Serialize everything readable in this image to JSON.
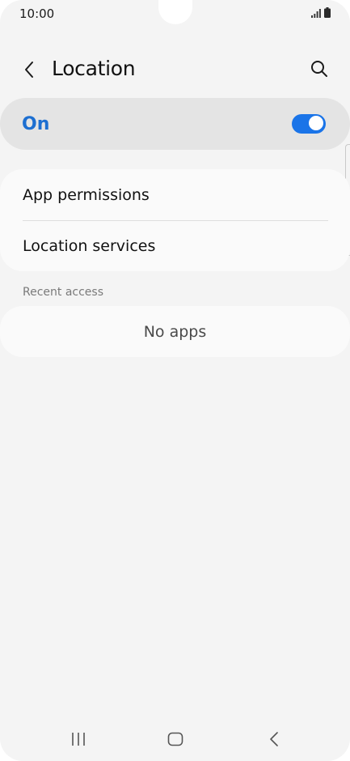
{
  "status_bar": {
    "time": "10:00",
    "icons": [
      "signal-icon",
      "battery-icon"
    ]
  },
  "header": {
    "title": "Location",
    "back_icon": "chevron-left-icon",
    "search_icon": "search-icon"
  },
  "master_toggle": {
    "label": "On",
    "checked": true,
    "accent": "#1a74e8",
    "label_color": "#1d6fd1"
  },
  "menu": {
    "items": [
      {
        "label": "App permissions"
      },
      {
        "label": "Location services"
      }
    ]
  },
  "recent_access": {
    "section_label": "Recent access",
    "empty_text": "No apps"
  },
  "nav_bar": {
    "icons": [
      "recents-icon",
      "home-icon",
      "back-icon"
    ]
  }
}
